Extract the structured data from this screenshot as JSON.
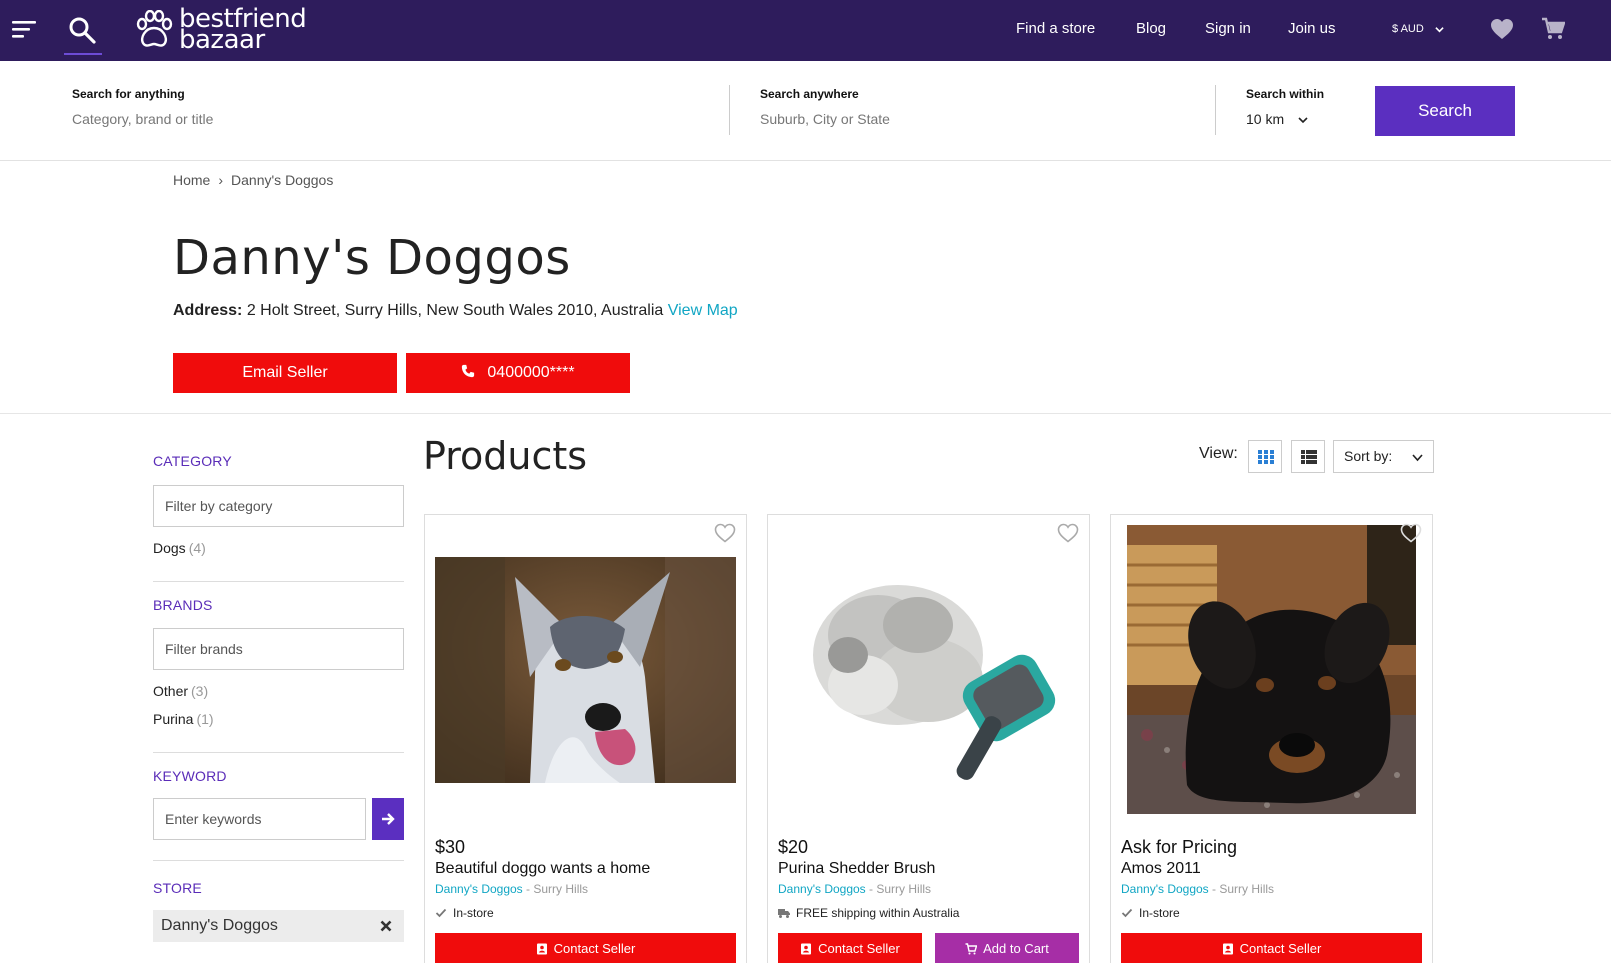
{
  "colors": {
    "brand": "#2e1c5c",
    "accent": "#5b2fc0",
    "red": "#f00c0c",
    "teal": "#11a6c4",
    "magenta": "#a62ea6"
  },
  "header": {
    "logo_line1": "bestfriend",
    "logo_line2": "bazaar",
    "nav": [
      "Find a store",
      "Blog",
      "Sign in",
      "Join us"
    ],
    "currency": "$ AUD"
  },
  "search": {
    "what_label": "Search for anything",
    "what_placeholder": "Category, brand or title",
    "where_label": "Search anywhere",
    "where_placeholder": "Suburb, City or State",
    "within_label": "Search within",
    "within_value": "10 km",
    "button": "Search"
  },
  "breadcrumb": {
    "home": "Home",
    "sep": "›",
    "current": "Danny's Doggos"
  },
  "store": {
    "name": "Danny's Doggos",
    "address_label": "Address:",
    "address": "2 Holt Street, Surry Hills, New South Wales 2010, Australia",
    "map_link": "View Map",
    "email_button": "Email Seller",
    "phone_button": "0400000****"
  },
  "sidebar": {
    "category_heading": "CATEGORY",
    "category_placeholder": "Filter by category",
    "categories": [
      {
        "label": "Dogs",
        "count": "(4)"
      }
    ],
    "brands_heading": "BRANDS",
    "brands_placeholder": "Filter brands",
    "brands": [
      {
        "label": "Other",
        "count": "(3)"
      },
      {
        "label": "Purina",
        "count": "(1)"
      }
    ],
    "keyword_heading": "KEYWORD",
    "keyword_placeholder": "Enter keywords",
    "store_heading": "STORE",
    "store_chip": "Danny's Doggos"
  },
  "products": {
    "heading": "Products",
    "view_label": "View:",
    "sort_label": "Sort by:",
    "items": [
      {
        "price": "$30",
        "title": "Beautiful doggo wants a home",
        "seller": "Danny's Doggos",
        "location": " - Surry Hills",
        "note": "In-store",
        "note_icon": "check-icon",
        "contact": "Contact Seller"
      },
      {
        "price": "$20",
        "title": "Purina Shedder Brush",
        "seller": "Danny's Doggos",
        "location": " - Surry Hills",
        "note": "FREE shipping within Australia",
        "note_icon": "truck-icon",
        "contact": "Contact Seller",
        "cart": "Add to Cart"
      },
      {
        "price": "Ask for Pricing",
        "title": "Amos 2011",
        "seller": "Danny's Doggos",
        "location": " - Surry Hills",
        "note": "In-store",
        "note_icon": "check-icon",
        "contact": "Contact Seller"
      }
    ]
  }
}
